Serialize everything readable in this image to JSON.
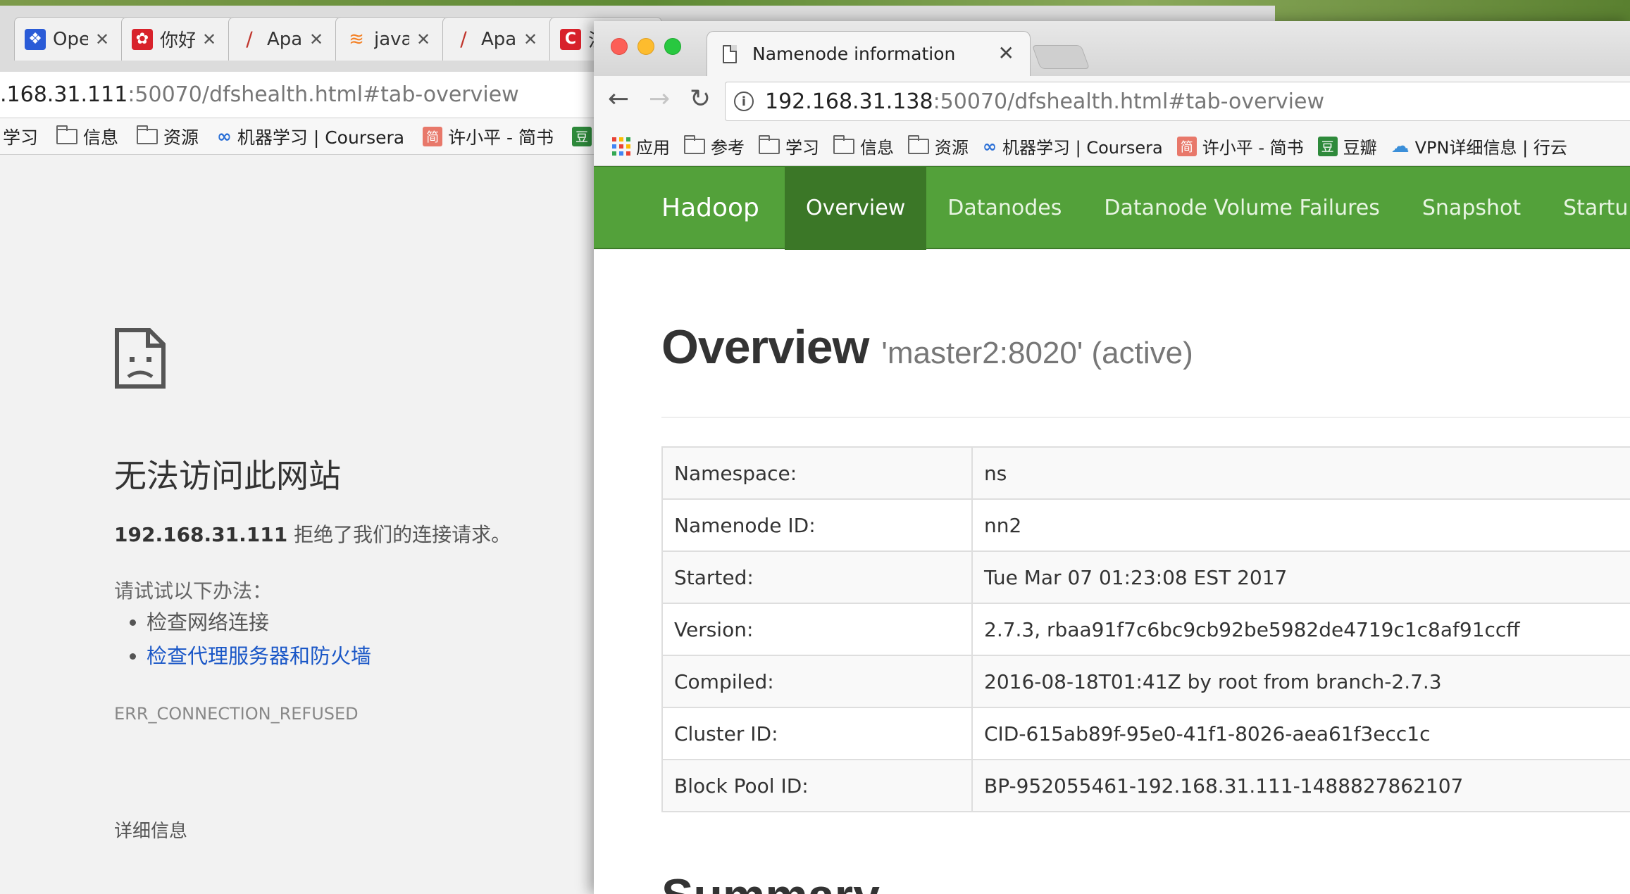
{
  "left_window": {
    "tabs": [
      {
        "label": "Ope",
        "icon": "paw-icon",
        "color": "#2a5bd7"
      },
      {
        "label": "你好",
        "icon": "brand-icon",
        "color": "#d8222b"
      },
      {
        "label": "Apa",
        "icon": "feather-icon",
        "color": "#c0342b"
      },
      {
        "label": "java",
        "icon": "stack-icon",
        "color": "#f48024"
      },
      {
        "label": "Apa",
        "icon": "feather-icon",
        "color": "#c0342b"
      },
      {
        "label": "注",
        "icon": "c-icon",
        "color": "#d8222b"
      }
    ],
    "address": {
      "host": ".168.31.111",
      "path": ":50070/dfshealth.html#tab-overview"
    },
    "bookmarks": [
      "学习",
      "信息",
      "资源",
      "机器学习 | Coursera",
      "许小平 - 简书"
    ],
    "error": {
      "title": "无法访问此网站",
      "host": "192.168.31.111",
      "message": " 拒绝了我们的连接请求。",
      "try_label": "请试试以下办法：",
      "suggestions": [
        "检查网络连接",
        "检查代理服务器和防火墙"
      ],
      "code": "ERR_CONNECTION_REFUSED",
      "details_label": "详细信息"
    }
  },
  "right_window": {
    "tab_title": "Namenode information",
    "address": {
      "host": "192.168.31.138",
      "path": ":50070/dfshealth.html#tab-overview"
    },
    "bookmarks": [
      "应用",
      "参考",
      "学习",
      "信息",
      "资源",
      "机器学习 | Coursera",
      "许小平 - 简书",
      "豆瓣",
      "VPN详细信息 | 行云"
    ],
    "hadoop": {
      "brand": "Hadoop",
      "nav": [
        "Overview",
        "Datanodes",
        "Datanode Volume Failures",
        "Snapshot",
        "Startup Prog"
      ],
      "active_nav": "Overview",
      "heading": "Overview",
      "subheading": "'master2:8020' (active)",
      "rows": [
        {
          "key": "Namespace:",
          "value": "ns"
        },
        {
          "key": "Namenode ID:",
          "value": "nn2"
        },
        {
          "key": "Started:",
          "value": "Tue Mar 07 01:23:08 EST 2017"
        },
        {
          "key": "Version:",
          "value": "2.7.3, rbaa91f7c6bc9cb92be5982de4719c1c8af91ccff"
        },
        {
          "key": "Compiled:",
          "value": "2016-08-18T01:41Z by root from branch-2.7.3"
        },
        {
          "key": "Cluster ID:",
          "value": "CID-615ab89f-95e0-41f1-8026-aea61f3ecc1c"
        },
        {
          "key": "Block Pool ID:",
          "value": "BP-952055461-192.168.31.111-1488827862107"
        }
      ],
      "summary_heading": "Summary"
    }
  },
  "colors": {
    "hadoop_green": "#53a13a",
    "hadoop_active": "#3b7727",
    "link_blue": "#1a57c7"
  }
}
